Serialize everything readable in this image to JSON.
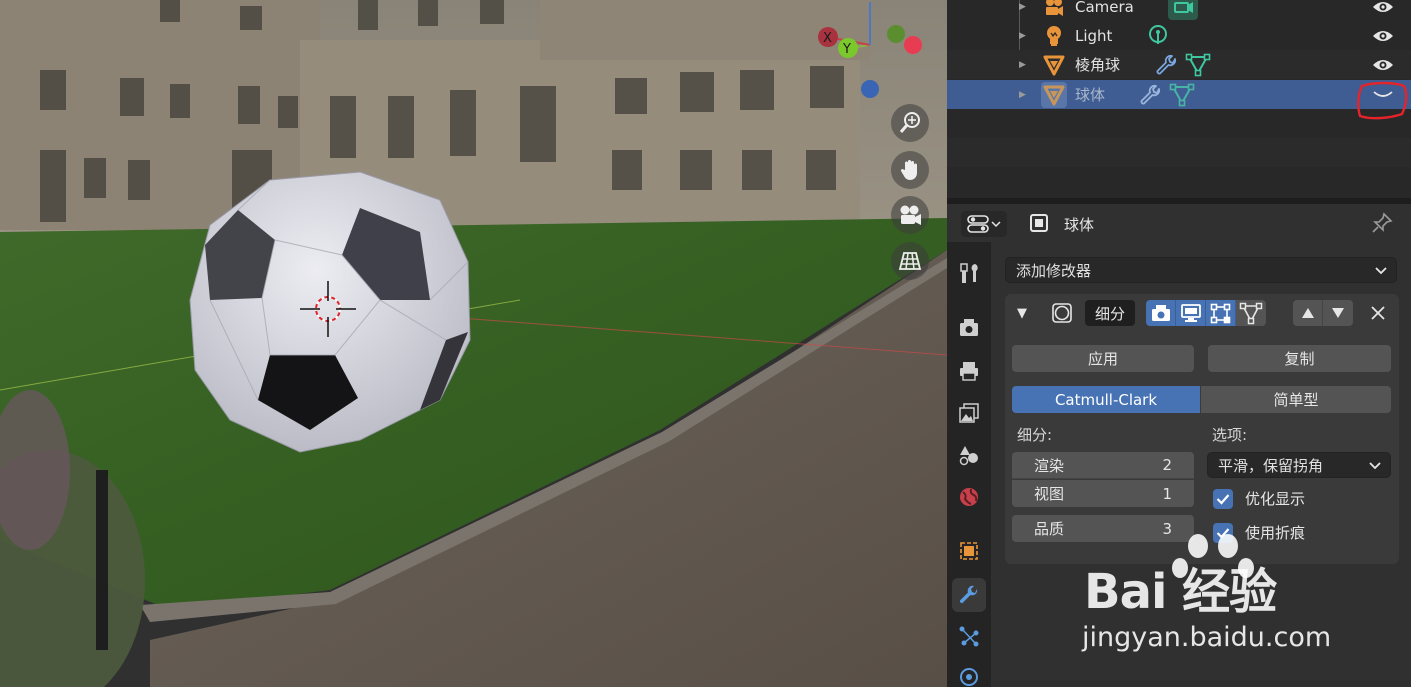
{
  "outliner": {
    "items": [
      {
        "name": "Camera",
        "type": "camera"
      },
      {
        "name": "Light",
        "type": "light"
      },
      {
        "name": "棱角球",
        "type": "mesh"
      },
      {
        "name": "球体",
        "type": "mesh",
        "selected": true,
        "hidden": true
      }
    ]
  },
  "properties": {
    "object_name": "球体",
    "add_modifier": "添加修改器",
    "modifier": {
      "name": "细分",
      "apply_label": "应用",
      "copy_label": "复制",
      "type_options": [
        "Catmull-Clark",
        "简单型"
      ],
      "type_selected": "Catmull-Clark",
      "levels_label": "细分:",
      "render_label": "渲染",
      "render_value": "2",
      "viewport_label": "视图",
      "viewport_value": "1",
      "quality_label": "品质",
      "quality_value": "3",
      "options_label": "选项:",
      "uv_smooth": "平滑，保留拐角",
      "optimal_display": "优化显示",
      "optimal_display_checked": true,
      "use_creases": "使用折痕",
      "use_creases_checked": true
    }
  },
  "gizmo": {
    "x": "X",
    "y": "Y"
  },
  "watermark": {
    "brand": "Bai 经验",
    "url": "jingyan.baidu.com"
  },
  "colors": {
    "accent": "#4772b3",
    "selected_row": "#3f5d92",
    "annotation": "#e5232a",
    "object_orange": "#e8943a",
    "data_green": "#3fc8a0"
  }
}
